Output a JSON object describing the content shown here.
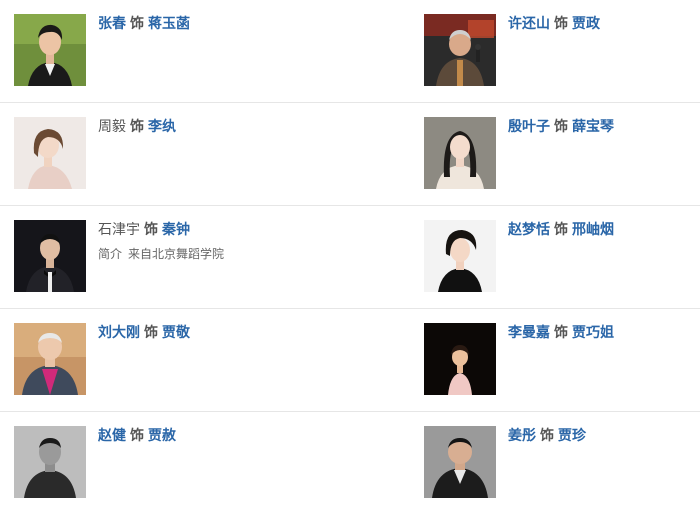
{
  "cast": [
    {
      "actor": "张春",
      "as": "饰",
      "role": "蒋玉菡",
      "actor_linked": true,
      "photo": "portrait-young-man-dark-suit"
    },
    {
      "actor": "许还山",
      "as": "饰",
      "role": "贾政",
      "actor_linked": true,
      "photo": "portrait-older-man-stage-microphone"
    },
    {
      "actor": "周毅",
      "as": "饰",
      "role": "李纨",
      "actor_linked": false,
      "photo": "portrait-woman-light-dress"
    },
    {
      "actor": "殷叶子",
      "as": "饰",
      "role": "薛宝琴",
      "actor_linked": true,
      "photo": "portrait-woman-long-hair"
    },
    {
      "actor": "石津宇",
      "as": "饰",
      "role": "秦钟",
      "actor_linked": false,
      "photo": "portrait-young-man-bow-tie",
      "intro_label": "简介",
      "intro_text": "来自北京舞蹈学院"
    },
    {
      "actor": "赵梦恬",
      "as": "饰",
      "role": "邢岫烟",
      "actor_linked": true,
      "photo": "portrait-woman-black-dress"
    },
    {
      "actor": "刘大刚",
      "as": "饰",
      "role": "贾敬",
      "actor_linked": true,
      "photo": "portrait-older-man-pink-shirt"
    },
    {
      "actor": "李曼嘉",
      "as": "饰",
      "role": "贾巧姐",
      "actor_linked": true,
      "photo": "portrait-girl-stage-dark"
    },
    {
      "actor": "赵健",
      "as": "饰",
      "role": "贾赦",
      "actor_linked": true,
      "photo": "portrait-man-black-and-white"
    },
    {
      "actor": "姜彤",
      "as": "饰",
      "role": "贾珍",
      "actor_linked": true,
      "photo": "portrait-man-dark-suit"
    }
  ],
  "colors": {
    "link": "#2a66a8",
    "text": "#555555",
    "divider": "#e6e6e6"
  }
}
